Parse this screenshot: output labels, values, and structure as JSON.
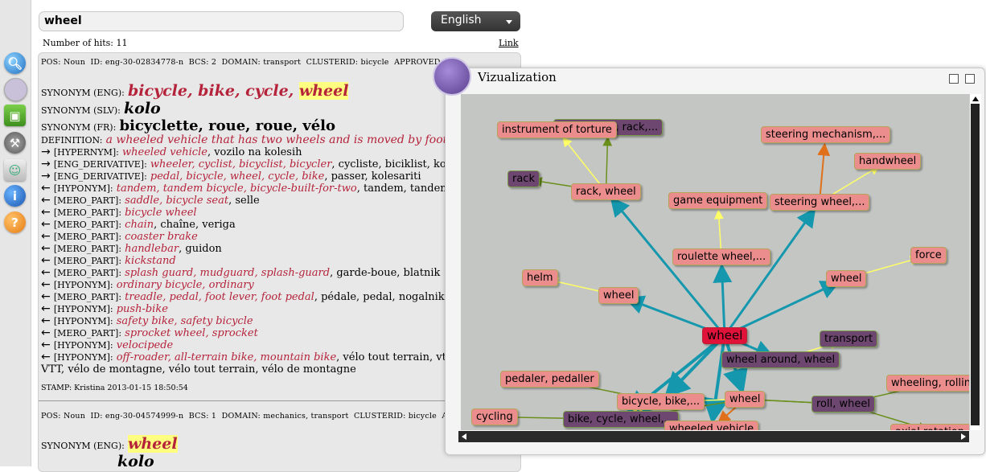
{
  "sidebar": {
    "items": [
      "search-icon",
      "network-icon",
      "image-icon",
      "wrench-icon",
      "users-icon",
      "info-icon",
      "help-icon"
    ]
  },
  "search": {
    "value": "wheel"
  },
  "language": {
    "selected": "English"
  },
  "results_header": {
    "hits": "Number of hits: 11",
    "link": "Link"
  },
  "entry1": {
    "pos": "Noun",
    "id": "eng-30-02834778-n",
    "bcs": "2",
    "domain": "transport",
    "clusterid": "bicycle",
    "syn_eng_label": "SYNONYM (ENG):",
    "syn_eng": "bicycle, bike, cycle, ",
    "syn_eng_hl": "wheel",
    "syn_slv_label": "SYNONYM (SLV):",
    "syn_slv": "kolo",
    "syn_fr_label": "SYNONYM (FR):",
    "syn_fr": "bicyclette, roue, roue, vélo",
    "def_label": "DEFINITION:",
    "definition": "a wheeled vehicle that has two wheels and is moved by foot pedals",
    "relations": [
      {
        "arrow": "→",
        "tag": "[HYPERNYM]:",
        "red": "wheeled vehicle",
        "rest": ", vozilo na kolesih"
      },
      {
        "arrow": "→",
        "tag": "[ENG_DERIVATIVE]:",
        "red": "wheeler, cyclist, bicyclist, bicycler",
        "rest": ", cycliste, biciklist, kolesar, v"
      },
      {
        "arrow": "→",
        "tag": "[ENG_DERIVATIVE]:",
        "red": "pedal, bicycle, wheel, cycle, bike",
        "rest": ", passer, kolesariti"
      },
      {
        "arrow": "←",
        "tag": "[HYPONYM]:",
        "red": "tandem, tandem bicycle, bicycle-built-for-two",
        "rest": ", tandem, tandem"
      },
      {
        "arrow": "←",
        "tag": "[MERO_PART]:",
        "red": "saddle, bicycle seat",
        "rest": ", selle"
      },
      {
        "arrow": "←",
        "tag": "[MERO_PART]:",
        "red": "bicycle wheel",
        "rest": ""
      },
      {
        "arrow": "←",
        "tag": "[MERO_PART]:",
        "red": "chain",
        "rest": ", chaîne, veriga"
      },
      {
        "arrow": "←",
        "tag": "[MERO_PART]:",
        "red": "coaster brake",
        "rest": ""
      },
      {
        "arrow": "←",
        "tag": "[MERO_PART]:",
        "red": "handlebar",
        "rest": ", guidon"
      },
      {
        "arrow": "←",
        "tag": "[MERO_PART]:",
        "red": "kickstand",
        "rest": ""
      },
      {
        "arrow": "←",
        "tag": "[MERO_PART]:",
        "red": "splash guard, mudguard, splash-guard",
        "rest": ", garde-boue, blatnik"
      },
      {
        "arrow": "←",
        "tag": "[HYPONYM]:",
        "red": "ordinary bicycle, ordinary",
        "rest": ""
      },
      {
        "arrow": "←",
        "tag": "[MERO_PART]:",
        "red": "treadle, pedal, foot lever, foot pedal",
        "rest": ", pédale, pedal, nogalnik"
      },
      {
        "arrow": "←",
        "tag": "[HYPONYM]:",
        "red": "push-bike",
        "rest": ""
      },
      {
        "arrow": "←",
        "tag": "[HYPONYM]:",
        "red": "safety bike, safety bicycle",
        "rest": ""
      },
      {
        "arrow": "←",
        "tag": "[MERO_PART]:",
        "red": "sprocket wheel, sprocket",
        "rest": ""
      },
      {
        "arrow": "←",
        "tag": "[HYPONYM]:",
        "red": "velocipede",
        "rest": ""
      },
      {
        "arrow": "←",
        "tag": "[HYPONYM]:",
        "red": "off-roader, all-terrain bike, mountain bike",
        "rest": ", vélo tout terrain, vtt, gars"
      }
    ],
    "tail": "VTT, vélo de montagne, vélo tout terrain, vélo de montagne",
    "stamp": "STAMP: Kristina 2013-01-15 18:50:54"
  },
  "entry2": {
    "pos": "Noun",
    "id": "eng-30-04574999-n",
    "bcs": "1",
    "domain": "mechanics, transport",
    "clusterid": "bicycle",
    "syn_eng_label": "SYNONYM (ENG):",
    "syn_eng_hl": "wheel",
    "syn_slv": "kolo"
  },
  "meta_labels": {
    "pos": "POS:",
    "id": "ID:",
    "bcs": "BCS:",
    "domain": "DOMAIN:",
    "clusterid": "CLUSTERID:",
    "approved": "APPROVED:"
  },
  "viz": {
    "title": "Vizualization"
  },
  "graph": {
    "nodes": [
      {
        "id": "wheel_c",
        "label": "wheel",
        "kind": "center"
      },
      {
        "id": "instr",
        "label": "instrument of torture",
        "kind": "pink"
      },
      {
        "id": "rackn",
        "label": "instrument, rack,...",
        "kind": "purple"
      },
      {
        "id": "rack",
        "label": "rack",
        "kind": "purple"
      },
      {
        "id": "rackwheel",
        "label": "rack, wheel",
        "kind": "pink"
      },
      {
        "id": "steermech",
        "label": "steering mechanism,...",
        "kind": "pink"
      },
      {
        "id": "handwheel",
        "label": "handwheel",
        "kind": "pink"
      },
      {
        "id": "gameeq",
        "label": "game equipment",
        "kind": "pink"
      },
      {
        "id": "steerwheel",
        "label": "steering wheel,...",
        "kind": "pink"
      },
      {
        "id": "roulette",
        "label": "roulette wheel,...",
        "kind": "pink"
      },
      {
        "id": "force",
        "label": "force",
        "kind": "pink"
      },
      {
        "id": "helm",
        "label": "helm",
        "kind": "pink"
      },
      {
        "id": "wheel1",
        "label": "wheel",
        "kind": "pink"
      },
      {
        "id": "wheel2",
        "label": "wheel",
        "kind": "pink"
      },
      {
        "id": "transport",
        "label": "transport",
        "kind": "purple"
      },
      {
        "id": "around",
        "label": "wheel around, wheel",
        "kind": "purple"
      },
      {
        "id": "pedaler",
        "label": "pedaler, pedaller",
        "kind": "pink"
      },
      {
        "id": "wheeling",
        "label": "wheeling, rolling",
        "kind": "pink"
      },
      {
        "id": "bicycle",
        "label": "bicycle, bike,...",
        "kind": "pink"
      },
      {
        "id": "wheel3",
        "label": "wheel",
        "kind": "pink"
      },
      {
        "id": "roll",
        "label": "roll, wheel",
        "kind": "purple"
      },
      {
        "id": "cycling",
        "label": "cycling",
        "kind": "pink"
      },
      {
        "id": "bikecycle",
        "label": "bike, cycle, wheel,...",
        "kind": "purple"
      },
      {
        "id": "wheeled",
        "label": "wheeled vehicle",
        "kind": "pink"
      },
      {
        "id": "axial",
        "label": "axial rotation,...",
        "kind": "pink"
      }
    ]
  }
}
